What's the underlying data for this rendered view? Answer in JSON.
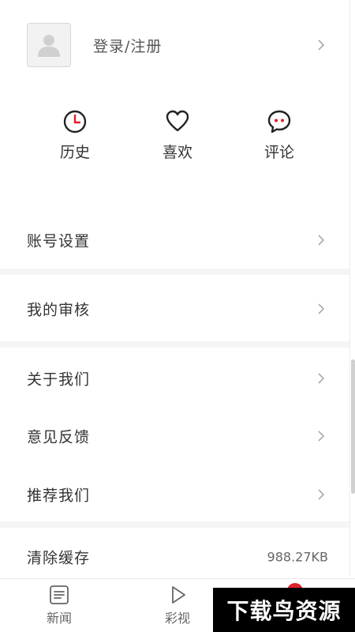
{
  "profile": {
    "login_label": "登录/注册"
  },
  "quick_actions": [
    {
      "label": "历史",
      "icon": "clock-icon"
    },
    {
      "label": "喜欢",
      "icon": "heart-icon"
    },
    {
      "label": "评论",
      "icon": "comment-icon"
    }
  ],
  "menu": {
    "account_settings": "账号设置",
    "my_review": "我的审核",
    "about_us": "关于我们",
    "feedback": "意见反馈",
    "recommend_us": "推荐我们",
    "clear_cache": "清除缓存",
    "cache_size": "988.27KB"
  },
  "tabbar": {
    "news": "新闻",
    "video": "彩视"
  },
  "watermark": "下载鸟资源",
  "colors": {
    "accent_red": "#e0202a",
    "text": "#333333",
    "muted": "#999999"
  }
}
